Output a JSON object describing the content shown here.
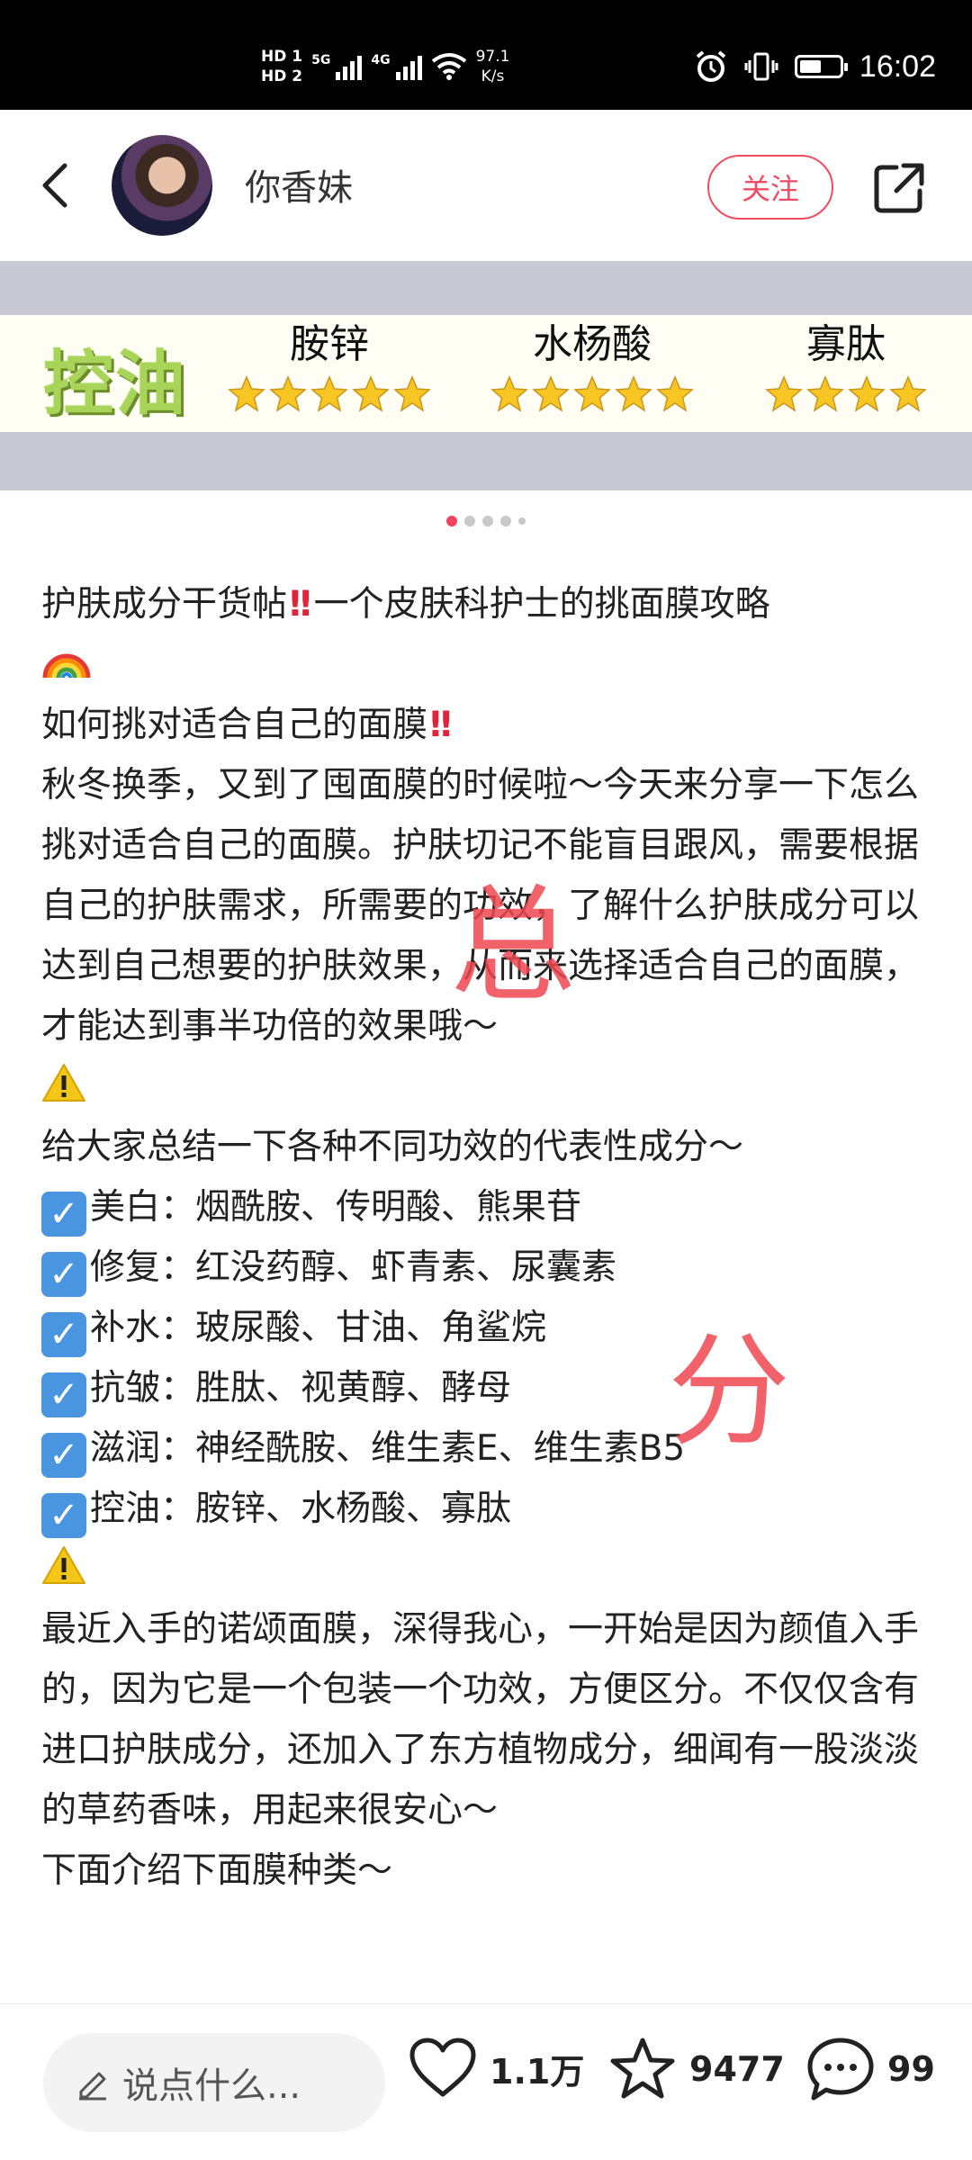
{
  "status_bar": {
    "hd1": "HD 1",
    "hd2": "HD 2",
    "net1": "5G",
    "net2": "4G",
    "speed_value": "97.1",
    "speed_unit": "K/s",
    "time": "16:02",
    "battery_level": 0.55
  },
  "header": {
    "username": "你香妹",
    "follow_label": "关注"
  },
  "banner": {
    "title": "控油",
    "ingredients": [
      {
        "name": "胺锌",
        "stars": 5
      },
      {
        "name": "水杨酸",
        "stars": 5
      },
      {
        "name": "寡肽",
        "stars": 4
      }
    ]
  },
  "pager": {
    "count": 5,
    "active": 0
  },
  "post": {
    "title_a": "护肤成分干货帖",
    "title_b": "一个皮肤科护士的挑面膜攻略",
    "line2": "如何挑对适合自己的面膜",
    "intro": "秋冬换季，又到了囤面膜的时候啦～今天来分享一下怎么挑对适合自己的面膜。护肤切记不能盲目跟风，需要根据自己的护肤需求，所需要的功效，了解什么护肤成分可以达到自己想要的护肤效果，从而来选择适合自己的面膜，才能达到事半功倍的效果哦～",
    "summary": "给大家总结一下各种不同功效的代表性成分～",
    "list": [
      "美白：烟酰胺、传明酸、熊果苷",
      "修复：红没药醇、虾青素、尿囊素",
      "补水：玻尿酸、甘油、角鲨烷",
      "抗皱：胜肽、视黄醇、酵母",
      "滋润：神经酰胺、维生素E、维生素B5",
      "控油：胺锌、水杨酸、寡肽"
    ],
    "para2": "最近入手的诺颂面膜，深得我心，一开始是因为颜值入手的，因为它是一个包装一个功效，方便区分。不仅仅含有进口护肤成分，还加入了东方植物成分，细闻有一股淡淡的草药香味，用起来很安心～",
    "para3": "下面介绍下面膜种类～"
  },
  "watermarks": [
    "总",
    "分"
  ],
  "bottom_bar": {
    "comment_placeholder": "说点什么...",
    "likes": "1.1万",
    "favorites": "9477",
    "comments": "99"
  },
  "colors": {
    "accent": "#f04c64",
    "banner_title": "#a8d45a",
    "star": "#f7c623",
    "checkbox": "#4a95e0"
  }
}
